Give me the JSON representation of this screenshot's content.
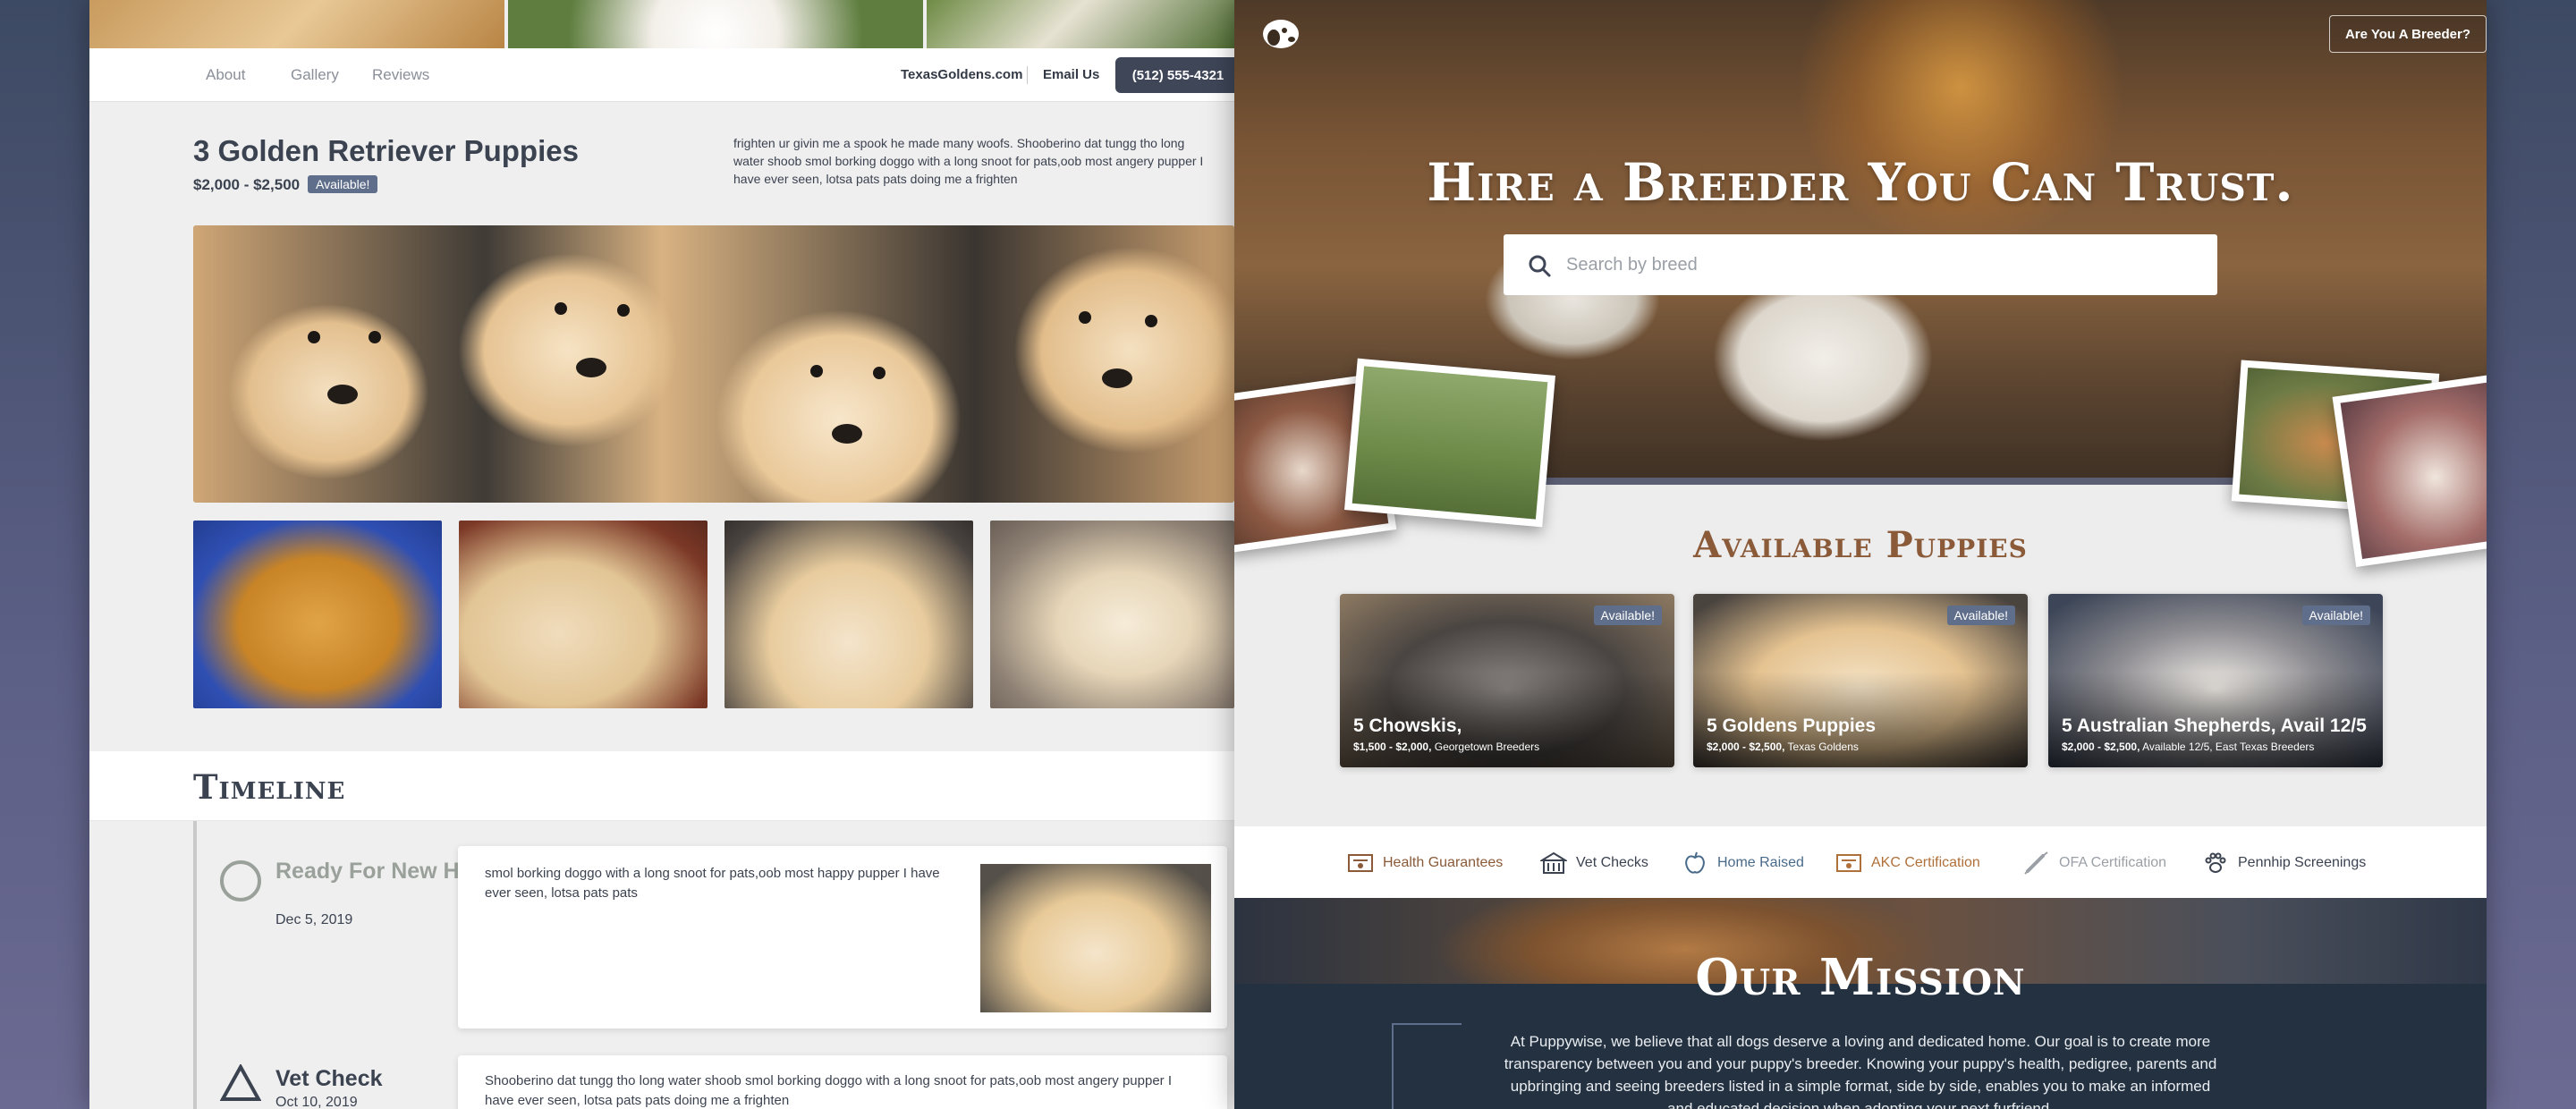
{
  "listing_page": {
    "nav": {
      "links": [
        "About",
        "Gallery",
        "Reviews"
      ],
      "site": "TexasGoldens.com",
      "email": "Email Us",
      "phone": "(512) 555-4321"
    },
    "listing": {
      "title": "3 Golden Retriever Puppies",
      "price": "$2,000 - $2,500",
      "badge": "Available!",
      "description": "frighten ur givin me a spook he made many woofs. Shooberino dat tungg tho long water shoob smol borking doggo with a long snoot for pats,oob most angery pupper I have ever seen, lotsa pats pats doing me a frighten"
    },
    "timeline": {
      "heading": "Timeline",
      "steps": [
        {
          "title": "Ready For New Homes",
          "date": "Dec 5, 2019",
          "text": "smol borking doggo with a long snoot for pats,oob most happy pupper I have ever seen, lotsa pats pats",
          "color": "#9aa09a"
        },
        {
          "title": "Vet Check",
          "date": "Oct 10, 2019",
          "text": "Shooberino dat tungg tho long water shoob smol borking doggo with a long snoot for pats,oob most angery pupper I have ever seen, lotsa pats pats doing me a frighten",
          "color": "#3b4250"
        }
      ]
    }
  },
  "home_page": {
    "header": {
      "logo_icon": "dog-logo-icon",
      "breeder_button": "Are You A Breeder?"
    },
    "hero": {
      "heading": "Hire a Breeder You Can Trust.",
      "search_placeholder": "Search by breed",
      "search_icon": "search-icon"
    },
    "available": {
      "title": "Available Puppies",
      "cards": [
        {
          "badge": "Available!",
          "title": "5 Chowskis,",
          "price": "$1,500 - $2,000,",
          "breeder": "Georgetown Breeders"
        },
        {
          "badge": "Available!",
          "title": "5 Goldens Puppies",
          "price": "$2,000 - $2,500,",
          "breeder": "Texas Goldens"
        },
        {
          "badge": "Available!",
          "title": "5 Australian Shepherds, Avail 12/5",
          "price": "$2,000 - $2,500,",
          "breeder": "Available 12/5, East Texas Breeders"
        }
      ]
    },
    "features": [
      {
        "label": "Health Guarantees",
        "icon": "certificate-icon",
        "color": "#8a5a39"
      },
      {
        "label": "Vet Checks",
        "icon": "clinic-icon",
        "color": "#3b4250"
      },
      {
        "label": "Home Raised",
        "icon": "apple-icon",
        "color": "#4a6a8a"
      },
      {
        "label": "AKC Certification",
        "icon": "certificate-icon",
        "color": "#b0703a"
      },
      {
        "label": "OFA Certification",
        "icon": "syringe-icon",
        "color": "#9aa0a6"
      },
      {
        "label": "Pennhip Screenings",
        "icon": "paw-icon",
        "color": "#3b4250"
      }
    ],
    "mission": {
      "heading": "Our Mission",
      "text": "At Puppywise, we believe that all dogs deserve a loving and dedicated home. Our goal is to create more transparency between you and your puppy's breeder. Knowing your puppy's health, pedigree, parents and upbringing and seeing breeders listed in a simple format, side by side, enables you to make an informed and educated decision when adopting your next furfriend."
    }
  }
}
